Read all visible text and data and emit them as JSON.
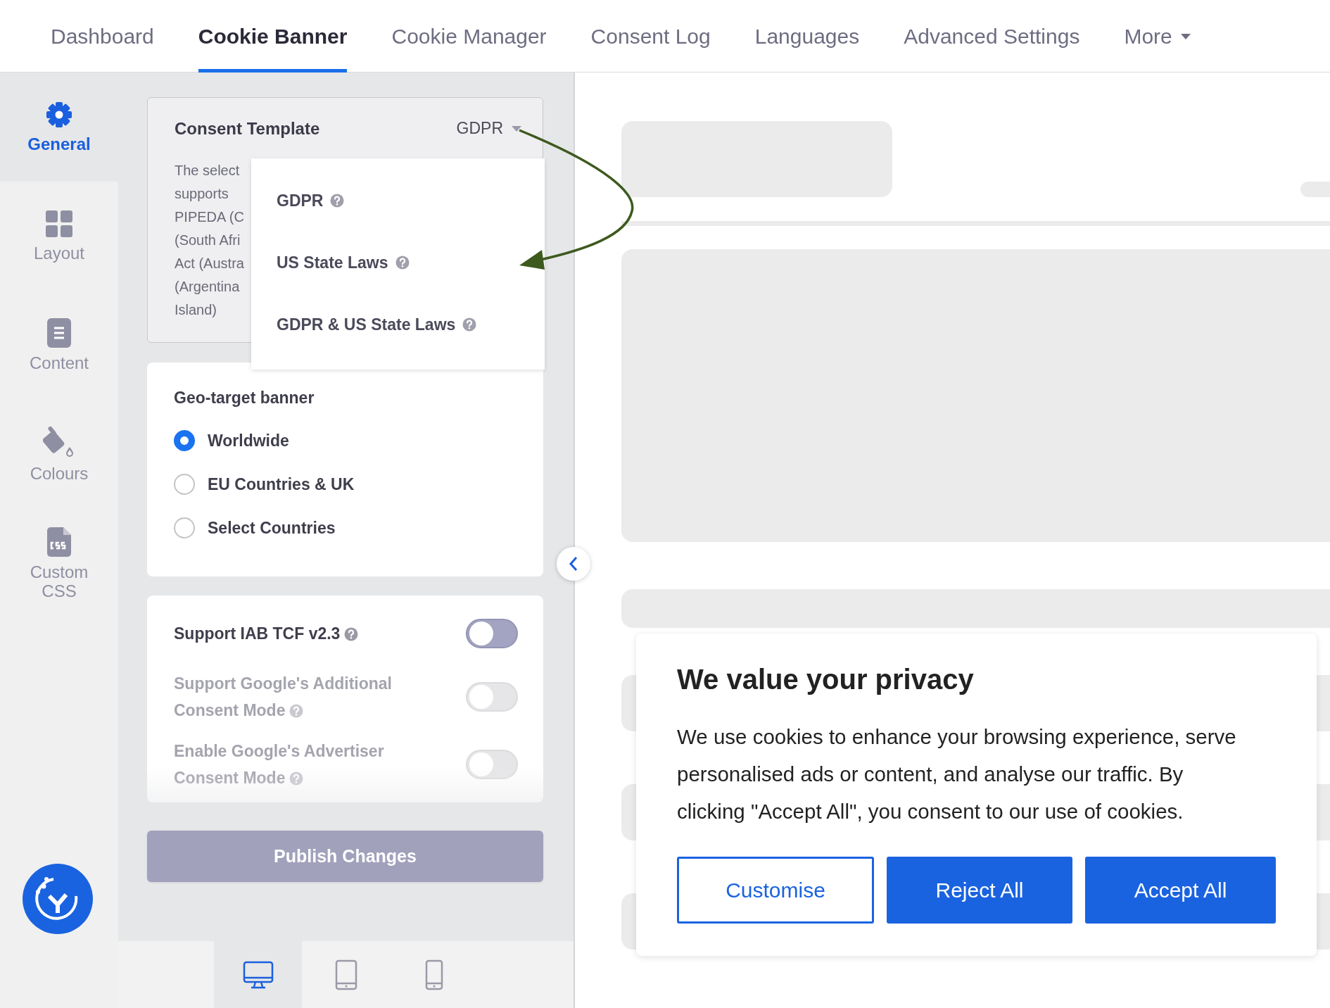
{
  "nav_tabs": [
    {
      "label": "Dashboard",
      "selected": false,
      "kind": "link"
    },
    {
      "label": "Cookie Banner",
      "selected": true,
      "kind": "link"
    },
    {
      "label": "Cookie Manager",
      "selected": false,
      "kind": "link"
    },
    {
      "label": "Consent Log",
      "selected": false,
      "kind": "link"
    },
    {
      "label": "Languages",
      "selected": false,
      "kind": "link"
    },
    {
      "label": "Advanced Settings",
      "selected": false,
      "kind": "link"
    },
    {
      "label": "More",
      "selected": false,
      "kind": "menu"
    }
  ],
  "sidebar": {
    "items": [
      {
        "label": "General",
        "selected": true
      },
      {
        "label": "Layout",
        "selected": false
      },
      {
        "label": "Content",
        "selected": false
      },
      {
        "label": "Colours",
        "selected": false
      },
      {
        "label": "Custom CSS",
        "selected": false
      }
    ]
  },
  "consent_template": {
    "label": "Consent Template",
    "value": "GDPR",
    "description_lines": [
      "The select",
      "supports",
      "PIPEDA (C",
      "(South Afri",
      "Act (Austra",
      "(Argentina",
      "Island)"
    ],
    "dropdown": {
      "expanded": true,
      "options": [
        {
          "label": "GDPR"
        },
        {
          "label": "US State Laws"
        },
        {
          "label": "GDPR & US State Laws"
        }
      ]
    }
  },
  "geo_target": {
    "title": "Geo-target banner",
    "options": [
      {
        "label": "Worldwide",
        "selected": true
      },
      {
        "label": "EU Countries & UK",
        "selected": false
      },
      {
        "label": "Select Countries",
        "selected": false
      }
    ]
  },
  "consent_settings": [
    {
      "label": "Support IAB TCF v2.3",
      "on": false,
      "disabled": false
    },
    {
      "label": "Support Google's Additional Consent Mode",
      "on": false,
      "disabled": true
    },
    {
      "label": "Enable Google's Advertiser Consent Mode",
      "on": false,
      "disabled": true
    }
  ],
  "publish_button": {
    "label": "Publish Changes",
    "disabled": true
  },
  "device_tabs": [
    {
      "selected": true
    },
    {
      "selected": false
    },
    {
      "selected": false
    }
  ],
  "banner": {
    "title": "We value your privacy",
    "message": "We use cookies to enhance your browsing experience, serve personalised ads or content, and analyse our traffic. By clicking \"Accept All\", you consent to our use of cookies.",
    "buttons": [
      {
        "label": "Customise",
        "kind": "outline"
      },
      {
        "label": "Reject All",
        "kind": "solid"
      },
      {
        "label": "Accept All",
        "kind": "solid"
      }
    ]
  }
}
